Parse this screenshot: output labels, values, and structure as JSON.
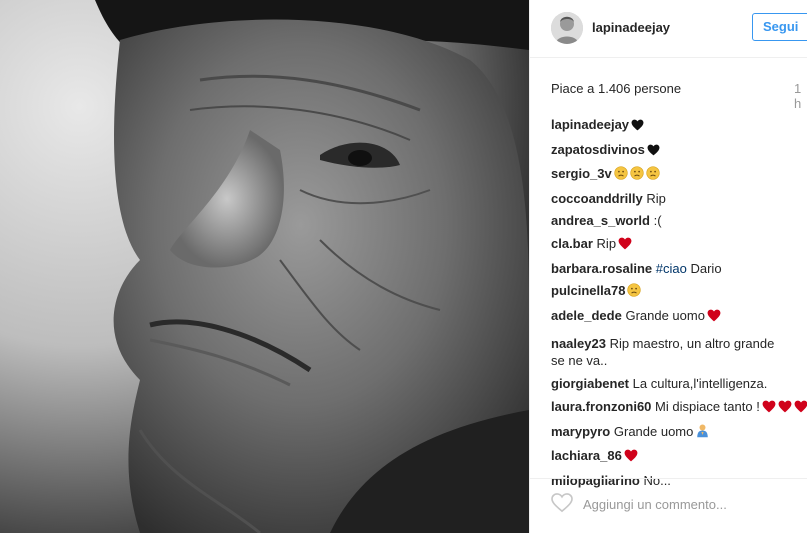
{
  "post": {
    "username": "lapinadeejay",
    "follow_label": "Segui",
    "likes_text": "Piace a 1.406 persone",
    "time_text": "1 h",
    "comment_placeholder": "Aggiungi un commento..."
  },
  "comments": [
    {
      "user": "lapinadeejay",
      "text": "",
      "emoji": [
        "black-heart"
      ]
    },
    {
      "user": "zapatosdivinos",
      "text": "",
      "emoji": [
        "black-heart"
      ]
    },
    {
      "user": "sergio_3v",
      "text": "",
      "emoji": [
        "sad-face",
        "sad-face",
        "sad-face"
      ]
    },
    {
      "user": "coccoanddrilly",
      "text": "Rip",
      "emoji": []
    },
    {
      "user": "andrea_s_world",
      "text": ":(",
      "emoji": []
    },
    {
      "user": "cla.bar",
      "text": "Rip",
      "emoji": [
        "red-heart"
      ]
    },
    {
      "user": "barbara.rosaline",
      "hashtag": "#ciao",
      "text": "Dario",
      "emoji": []
    },
    {
      "user": "pulcinella78",
      "text": "",
      "emoji": [
        "sad-face"
      ]
    },
    {
      "user": "adele_dede",
      "text": "Grande uomo",
      "emoji": [
        "red-heart"
      ]
    },
    {
      "user": "naaley23",
      "text": "Rip maestro, un altro grande se ne va..",
      "emoji": []
    },
    {
      "user": "giorgiabenet",
      "text": "La cultura,l'intelligenza.",
      "emoji": []
    },
    {
      "user": "laura.fronzoni60",
      "text": "Mi dispiace tanto !",
      "emoji": [
        "red-heart",
        "red-heart",
        "red-heart"
      ]
    },
    {
      "user": "marypyro",
      "text": "Grande uomo",
      "emoji": [
        "praying-person"
      ]
    },
    {
      "user": "lachiara_86",
      "text": "",
      "emoji": [
        "red-heart"
      ]
    },
    {
      "user": "milopagliarino",
      "text": "No...",
      "emoji": []
    }
  ],
  "colors": {
    "follow_blue": "#3897f0",
    "hashtag": "#003569",
    "heart_red": "#d0021b"
  }
}
